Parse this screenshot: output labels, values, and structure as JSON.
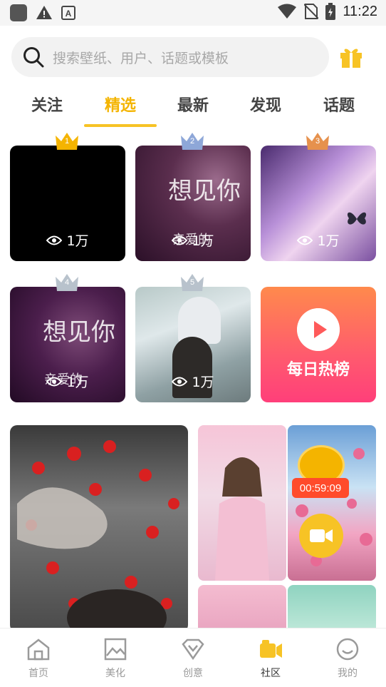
{
  "status_bar": {
    "time": "11:22",
    "left_icons": [
      "app-icon",
      "warning-icon",
      "font-icon"
    ],
    "right_icons": [
      "wifi-icon",
      "no-sim-icon",
      "battery-icon"
    ]
  },
  "search": {
    "placeholder": "搜索壁纸、用户、话题或模板"
  },
  "tabs": [
    {
      "label": "关注"
    },
    {
      "label": "精选"
    },
    {
      "label": "最新"
    },
    {
      "label": "发现"
    },
    {
      "label": "话题"
    }
  ],
  "active_tab": "精选",
  "grid": [
    {
      "rank": "1",
      "views": "1万",
      "crown_color": "#f5b400"
    },
    {
      "rank": "2",
      "views": "1万",
      "crown_color": "#8ea7d8",
      "overlay": "想见你",
      "overlay_sub": "亲爱的"
    },
    {
      "rank": "3",
      "views": "1万",
      "crown_color": "#e6914d"
    },
    {
      "rank": "4",
      "views": "1万",
      "crown_color": "#b8c2cc",
      "overlay": "想见你",
      "overlay_sub": "亲爱的"
    },
    {
      "rank": "5",
      "views": "1万",
      "crown_color": "#b8c2cc"
    }
  ],
  "hot_list": {
    "label": "每日热榜"
  },
  "feed": {
    "timer": "00:59:09"
  },
  "bottom_nav": [
    {
      "label": "首页",
      "icon": "home-icon"
    },
    {
      "label": "美化",
      "icon": "image-icon"
    },
    {
      "label": "创意",
      "icon": "diamond-icon"
    },
    {
      "label": "社区",
      "icon": "community-icon"
    },
    {
      "label": "我的",
      "icon": "profile-icon"
    }
  ],
  "active_nav": "社区",
  "colors": {
    "accent": "#f4b400",
    "hot_gradient_start": "#ff8a4c",
    "hot_gradient_end": "#ff3f7a"
  }
}
